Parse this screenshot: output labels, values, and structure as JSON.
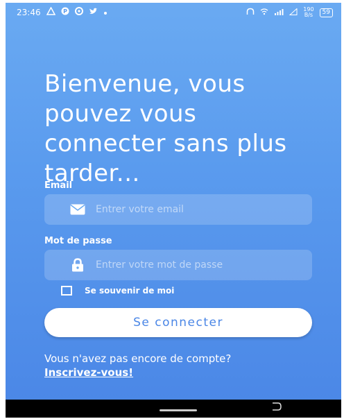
{
  "status_bar": {
    "time": "23:46",
    "net_speed_value": "190",
    "net_speed_unit": "B/s",
    "battery": "59"
  },
  "heading": "Bienvenue, vous pouvez vous connecter sans plus tarder...",
  "email": {
    "label": "Email",
    "placeholder": "Entrer votre email",
    "value": ""
  },
  "password": {
    "label": "Mot de passe",
    "placeholder": "Entrer votre mot de passe",
    "value": ""
  },
  "remember_me": {
    "label": "Se souvenir de moi",
    "checked": false
  },
  "login_button": "Se connecter",
  "signup": {
    "prompt": "Vous n'avez pas encore de compte? ",
    "link": "Inscrivez-vous!"
  },
  "colors": {
    "gradient_top": "#6aaaf2",
    "gradient_bottom": "#4a86e6",
    "button_text": "#4a86e6"
  }
}
